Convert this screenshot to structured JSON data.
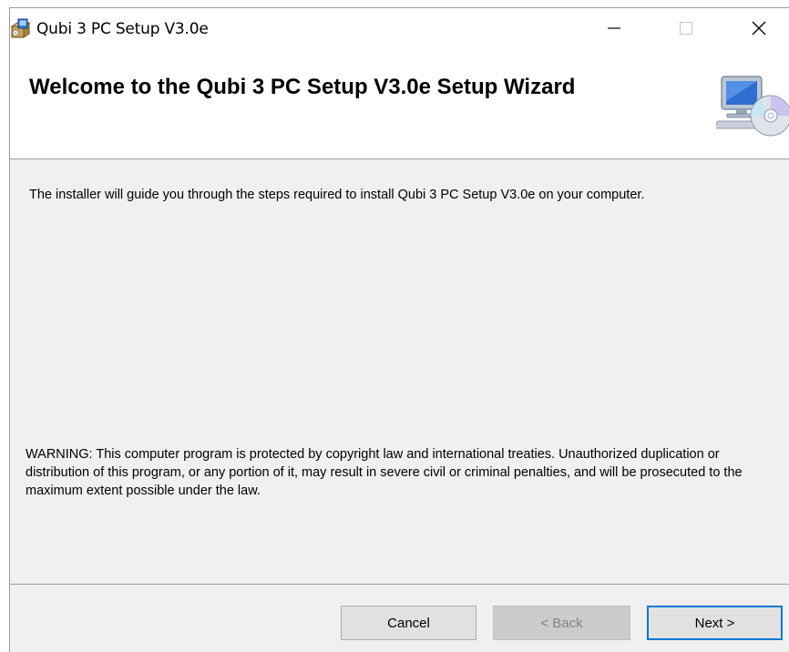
{
  "window": {
    "title": "Qubi 3 PC Setup V3.0e"
  },
  "header": {
    "title": "Welcome to the Qubi 3 PC Setup V3.0e Setup Wizard"
  },
  "body": {
    "intro": "The installer will guide you through the steps required to install Qubi 3 PC Setup V3.0e on your computer.",
    "warning": "WARNING: This computer program is protected by copyright law and international treaties. Unauthorized duplication or distribution of this program, or any portion of it, may result in severe civil or criminal penalties, and will be prosecuted to the maximum extent possible under the law."
  },
  "buttons": {
    "cancel": "Cancel",
    "back": "< Back",
    "next": "Next >"
  },
  "icons": {
    "app": "installer-package-icon",
    "header": "computer-cd-icon",
    "minimize": "minimize-icon",
    "maximize": "maximize-icon",
    "close": "close-icon"
  },
  "colors": {
    "default_button_border": "#0078d7",
    "disabled_text": "#838383"
  }
}
